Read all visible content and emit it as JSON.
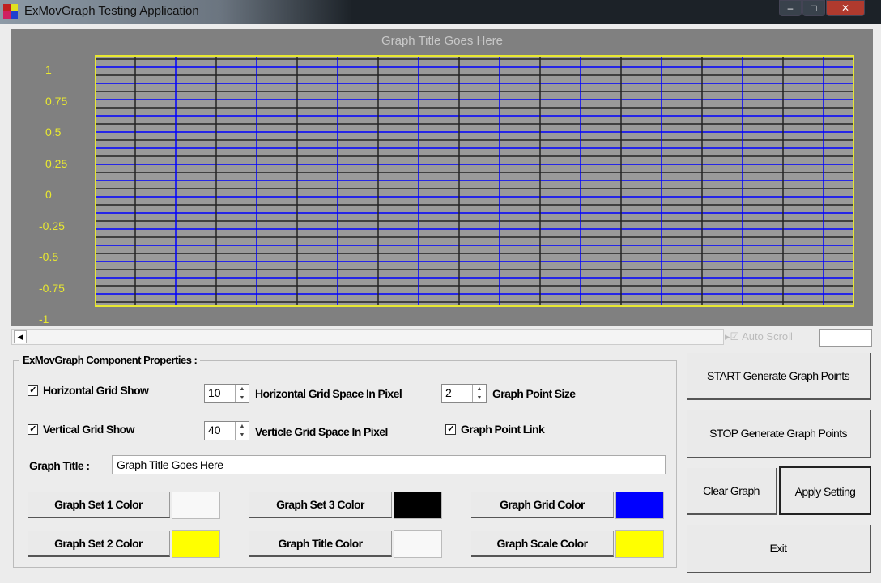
{
  "window": {
    "title": "ExMovGraph Testing Application",
    "min": "–",
    "max": "□",
    "close": "✕"
  },
  "graph": {
    "title": "Graph Title Goes Here",
    "y_labels": [
      "1",
      "0.75",
      "0.5",
      "0.25",
      "0",
      "-0.25",
      "-0.5",
      "-0.75",
      "-1"
    ],
    "colors": {
      "grid": "#0000ff",
      "scale": "#ffff00",
      "background": "#9a9a9a"
    }
  },
  "auto_scroll": {
    "label": "Auto Scroll",
    "checked": true
  },
  "props": {
    "group_title": "ExMovGraph Component Properties :",
    "h_grid_show": "Horizontal Grid Show",
    "v_grid_show": "Vertical Grid Show",
    "h_grid_space": "10",
    "h_grid_space_label": "Horizontal Grid Space In Pixel",
    "v_grid_space": "40",
    "v_grid_space_label": "Verticle Grid Space In Pixel",
    "point_size": "2",
    "point_size_label": "Graph Point Size",
    "point_link": "Graph Point Link",
    "title_label": "Graph Title :",
    "title_value": "Graph  Title Goes Here",
    "set1": "Graph Set 1 Color",
    "set2": "Graph Set 2 Color",
    "set3": "Graph Set 3 Color",
    "title_color": "Graph Title Color",
    "grid_color": "Graph Grid Color",
    "scale_color": "Graph Scale Color",
    "check": "✓"
  },
  "buttons": {
    "start": "START Generate Graph Points",
    "stop": "STOP Generate Graph Points",
    "clear": "Clear Graph",
    "apply": "Apply Setting",
    "exit": "Exit"
  }
}
